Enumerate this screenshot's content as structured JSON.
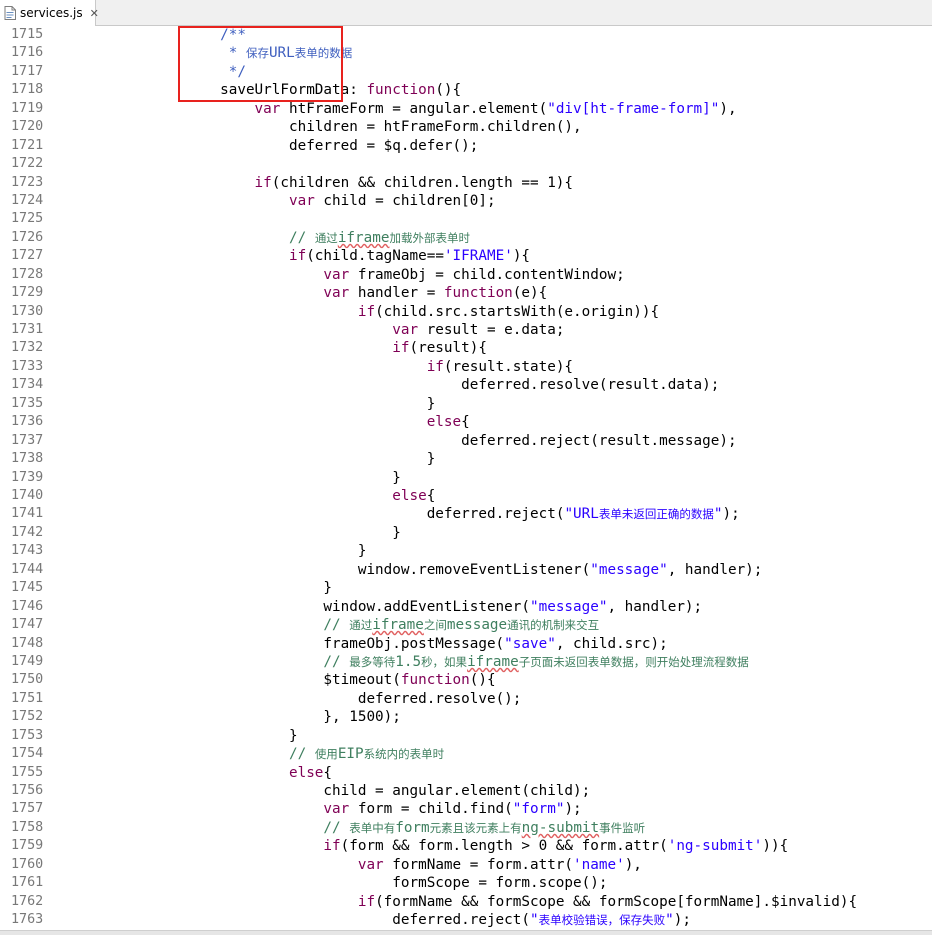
{
  "tab": {
    "filename": "services.js",
    "file_icon": "js-file-icon",
    "close_icon": "close-icon"
  },
  "code": [
    {
      "ln": "1715",
      "indent": "               ",
      "segs": [
        [
          "d",
          "/**"
        ]
      ]
    },
    {
      "ln": "1716",
      "indent": "                ",
      "segs": [
        [
          "d",
          "* "
        ],
        [
          "d cn",
          "保存"
        ],
        [
          "d",
          "URL"
        ],
        [
          "d cn",
          "表单的数据"
        ]
      ]
    },
    {
      "ln": "1717",
      "indent": "                ",
      "segs": [
        [
          "d",
          "*/"
        ]
      ]
    },
    {
      "ln": "1718",
      "indent": "               ",
      "segs": [
        [
          "",
          "saveUrlFormData: "
        ],
        [
          "k",
          "function"
        ],
        [
          "",
          "(){"
        ]
      ]
    },
    {
      "ln": "1719",
      "indent": "                   ",
      "segs": [
        [
          "k",
          "var"
        ],
        [
          "",
          " htFrameForm = angular.element("
        ],
        [
          "s",
          "\"div[ht-frame-form]\""
        ],
        [
          "",
          "),"
        ]
      ]
    },
    {
      "ln": "1720",
      "indent": "                       ",
      "segs": [
        [
          "",
          "children = htFrameForm.children(),"
        ]
      ]
    },
    {
      "ln": "1721",
      "indent": "                       ",
      "segs": [
        [
          "",
          "deferred = $q.defer();"
        ]
      ]
    },
    {
      "ln": "1722",
      "indent": "",
      "segs": []
    },
    {
      "ln": "1723",
      "indent": "                   ",
      "segs": [
        [
          "k",
          "if"
        ],
        [
          "",
          "(children && children.length == 1){"
        ]
      ]
    },
    {
      "ln": "1724",
      "indent": "                       ",
      "segs": [
        [
          "k",
          "var"
        ],
        [
          "",
          " child = children[0];"
        ]
      ]
    },
    {
      "ln": "1725",
      "indent": "",
      "segs": []
    },
    {
      "ln": "1726",
      "indent": "                       ",
      "segs": [
        [
          "c",
          "// "
        ],
        [
          "c cn",
          "通过"
        ],
        [
          "c sq",
          "iframe"
        ],
        [
          "c cn",
          "加载外部表单时"
        ]
      ]
    },
    {
      "ln": "1727",
      "indent": "                       ",
      "segs": [
        [
          "k",
          "if"
        ],
        [
          "",
          "(child.tagName=="
        ],
        [
          "s",
          "'IFRAME'"
        ],
        [
          "",
          "){"
        ]
      ]
    },
    {
      "ln": "1728",
      "indent": "                           ",
      "segs": [
        [
          "k",
          "var"
        ],
        [
          "",
          " frameObj = child.contentWindow;"
        ]
      ]
    },
    {
      "ln": "1729",
      "indent": "                           ",
      "segs": [
        [
          "k",
          "var"
        ],
        [
          "",
          " handler = "
        ],
        [
          "k",
          "function"
        ],
        [
          "",
          "(e){"
        ]
      ]
    },
    {
      "ln": "1730",
      "indent": "                               ",
      "segs": [
        [
          "k",
          "if"
        ],
        [
          "",
          "(child.src.startsWith(e.origin)){"
        ]
      ]
    },
    {
      "ln": "1731",
      "indent": "                                   ",
      "segs": [
        [
          "k",
          "var"
        ],
        [
          "",
          " result = e.data;"
        ]
      ]
    },
    {
      "ln": "1732",
      "indent": "                                   ",
      "segs": [
        [
          "k",
          "if"
        ],
        [
          "",
          "(result){"
        ]
      ]
    },
    {
      "ln": "1733",
      "indent": "                                       ",
      "segs": [
        [
          "k",
          "if"
        ],
        [
          "",
          "(result.state){"
        ]
      ]
    },
    {
      "ln": "1734",
      "indent": "                                           ",
      "segs": [
        [
          "",
          "deferred.resolve(result.data);"
        ]
      ]
    },
    {
      "ln": "1735",
      "indent": "                                       ",
      "segs": [
        [
          "",
          "}"
        ]
      ]
    },
    {
      "ln": "1736",
      "indent": "                                       ",
      "segs": [
        [
          "k",
          "else"
        ],
        [
          "",
          "{"
        ]
      ]
    },
    {
      "ln": "1737",
      "indent": "                                           ",
      "segs": [
        [
          "",
          "deferred.reject(result.message);"
        ]
      ]
    },
    {
      "ln": "1738",
      "indent": "                                       ",
      "segs": [
        [
          "",
          "}"
        ]
      ]
    },
    {
      "ln": "1739",
      "indent": "                                   ",
      "segs": [
        [
          "",
          "}"
        ]
      ]
    },
    {
      "ln": "1740",
      "indent": "                                   ",
      "segs": [
        [
          "k",
          "else"
        ],
        [
          "",
          "{"
        ]
      ]
    },
    {
      "ln": "1741",
      "indent": "                                       ",
      "segs": [
        [
          "",
          "deferred.reject("
        ],
        [
          "s",
          "\"URL"
        ],
        [
          "s cn",
          "表单未返回正确的数据"
        ],
        [
          "s",
          "\""
        ],
        [
          "",
          ");"
        ]
      ]
    },
    {
      "ln": "1742",
      "indent": "                                   ",
      "segs": [
        [
          "",
          "}"
        ]
      ]
    },
    {
      "ln": "1743",
      "indent": "                               ",
      "segs": [
        [
          "",
          "}"
        ]
      ]
    },
    {
      "ln": "1744",
      "indent": "                               ",
      "segs": [
        [
          "",
          "window.removeEventListener("
        ],
        [
          "s",
          "\"message\""
        ],
        [
          "",
          ", handler);"
        ]
      ]
    },
    {
      "ln": "1745",
      "indent": "                           ",
      "segs": [
        [
          "",
          "}"
        ]
      ]
    },
    {
      "ln": "1746",
      "indent": "                           ",
      "segs": [
        [
          "",
          "window.addEventListener("
        ],
        [
          "s",
          "\"message\""
        ],
        [
          "",
          ", handler);"
        ]
      ]
    },
    {
      "ln": "1747",
      "indent": "                           ",
      "segs": [
        [
          "c",
          "// "
        ],
        [
          "c cn",
          "通过"
        ],
        [
          "c sq",
          "iframe"
        ],
        [
          "c cn",
          "之间"
        ],
        [
          "c",
          "message"
        ],
        [
          "c cn",
          "通讯的机制来交互"
        ]
      ]
    },
    {
      "ln": "1748",
      "indent": "                           ",
      "segs": [
        [
          "",
          "frameObj.postMessage("
        ],
        [
          "s",
          "\"save\""
        ],
        [
          "",
          ", child.src);"
        ]
      ]
    },
    {
      "ln": "1749",
      "indent": "                           ",
      "segs": [
        [
          "c",
          "// "
        ],
        [
          "c cn",
          "最多等待"
        ],
        [
          "c",
          "1.5"
        ],
        [
          "c cn",
          "秒，如果"
        ],
        [
          "c sq",
          "iframe"
        ],
        [
          "c cn",
          "子页面未返回表单数据，则开始处理流程数据"
        ]
      ]
    },
    {
      "ln": "1750",
      "indent": "                           ",
      "segs": [
        [
          "",
          "$timeout("
        ],
        [
          "k",
          "function"
        ],
        [
          "",
          "(){"
        ]
      ]
    },
    {
      "ln": "1751",
      "indent": "                               ",
      "segs": [
        [
          "",
          "deferred.resolve();"
        ]
      ]
    },
    {
      "ln": "1752",
      "indent": "                           ",
      "segs": [
        [
          "",
          "}, 1500);"
        ]
      ]
    },
    {
      "ln": "1753",
      "indent": "                       ",
      "segs": [
        [
          "",
          "}"
        ]
      ]
    },
    {
      "ln": "1754",
      "indent": "                       ",
      "segs": [
        [
          "c",
          "// "
        ],
        [
          "c cn",
          "使用"
        ],
        [
          "c",
          "EIP"
        ],
        [
          "c cn",
          "系统内的表单时"
        ]
      ]
    },
    {
      "ln": "1755",
      "indent": "                       ",
      "segs": [
        [
          "k",
          "else"
        ],
        [
          "",
          "{"
        ]
      ]
    },
    {
      "ln": "1756",
      "indent": "                           ",
      "segs": [
        [
          "",
          "child = angular.element(child);"
        ]
      ]
    },
    {
      "ln": "1757",
      "indent": "                           ",
      "segs": [
        [
          "k",
          "var"
        ],
        [
          "",
          " form = child.find("
        ],
        [
          "s",
          "\"form\""
        ],
        [
          "",
          ");"
        ]
      ]
    },
    {
      "ln": "1758",
      "indent": "                           ",
      "segs": [
        [
          "c",
          "// "
        ],
        [
          "c cn",
          "表单中有"
        ],
        [
          "c",
          "form"
        ],
        [
          "c cn",
          "元素且该元素上有"
        ],
        [
          "c sq",
          "ng-submit"
        ],
        [
          "c cn",
          "事件监听"
        ]
      ]
    },
    {
      "ln": "1759",
      "indent": "                           ",
      "segs": [
        [
          "k",
          "if"
        ],
        [
          "",
          "(form && form.length > 0 && form.attr("
        ],
        [
          "s",
          "'ng-submit'"
        ],
        [
          "",
          "))"
        ],
        [
          "",
          "{"
        ]
      ]
    },
    {
      "ln": "1760",
      "indent": "                               ",
      "segs": [
        [
          "k",
          "var"
        ],
        [
          "",
          " formName = form.attr("
        ],
        [
          "s",
          "'name'"
        ],
        [
          "",
          "),"
        ]
      ]
    },
    {
      "ln": "1761",
      "indent": "                                   ",
      "segs": [
        [
          "",
          "formScope = form.scope();"
        ]
      ]
    },
    {
      "ln": "1762",
      "indent": "                               ",
      "segs": [
        [
          "k",
          "if"
        ],
        [
          "",
          "(formName && formScope && formScope[formName].$invalid){"
        ]
      ]
    },
    {
      "ln": "1763",
      "indent": "                                   ",
      "segs": [
        [
          "",
          "deferred.reject("
        ],
        [
          "s",
          "\""
        ],
        [
          "s cn",
          "表单校验错误，保存失败"
        ],
        [
          "s",
          "\""
        ],
        [
          "",
          ");"
        ]
      ]
    }
  ]
}
